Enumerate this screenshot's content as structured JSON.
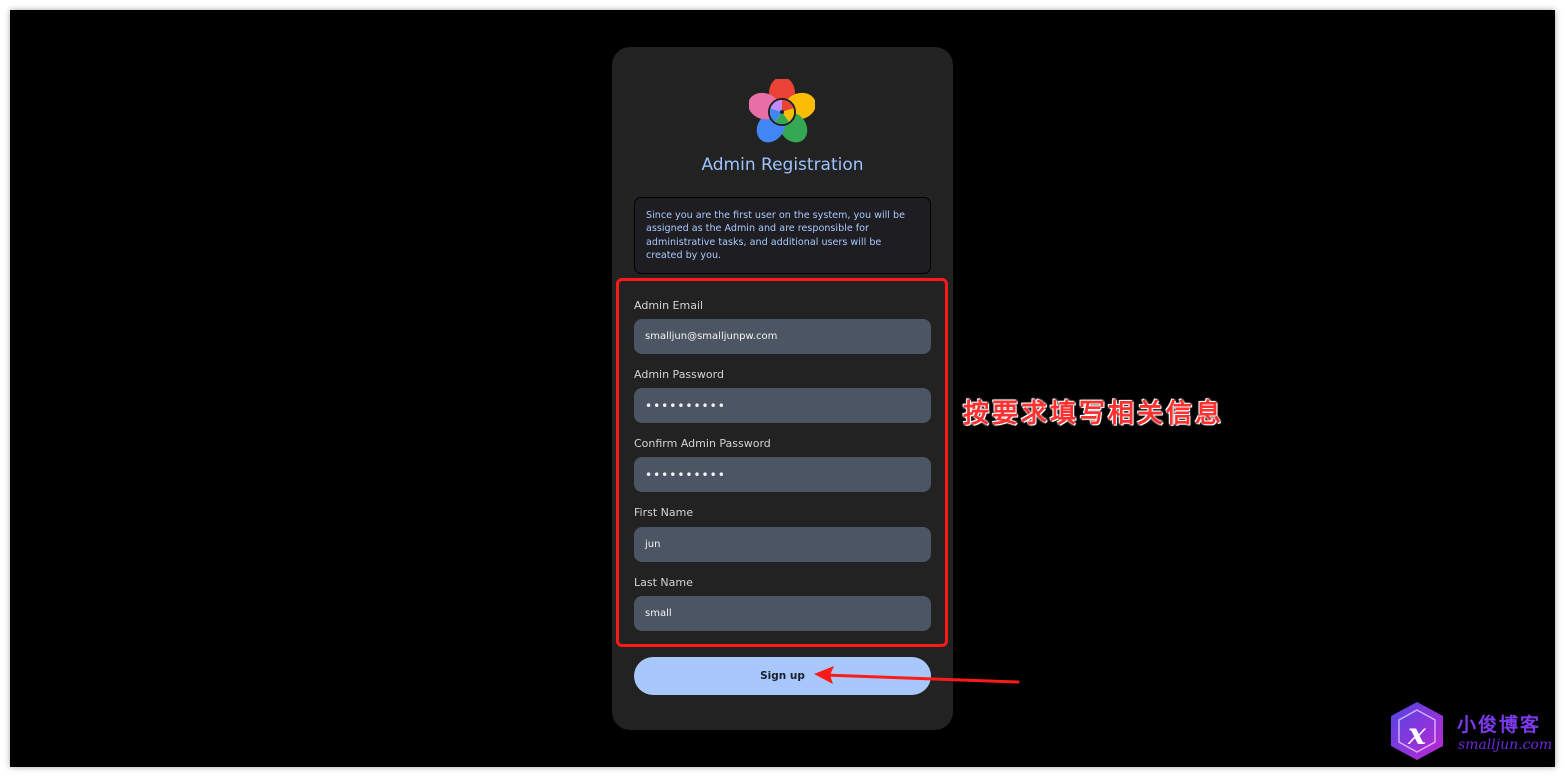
{
  "registration": {
    "title": "Admin Registration",
    "notice": "Since you are the first user on the system, you will be assigned as the Admin and are responsible for administrative tasks, and additional users will be created by you.",
    "fields": [
      {
        "label": "Admin Email",
        "value": "smalljun@smalljunpw.com",
        "type": "email"
      },
      {
        "label": "Admin Password",
        "value": "••••••••••",
        "type": "password"
      },
      {
        "label": "Confirm Admin Password",
        "value": "••••••••••",
        "type": "password"
      },
      {
        "label": "First Name",
        "value": "jun",
        "type": "text"
      },
      {
        "label": "Last Name",
        "value": "small",
        "type": "text"
      }
    ],
    "signup_label": "Sign up"
  },
  "annotation": {
    "text": "按要求填写相关信息",
    "color": "#ff3030"
  },
  "watermark": {
    "title": "小俊博客",
    "url": "smalljun.com"
  },
  "colors": {
    "background": "#000000",
    "card": "#222222",
    "accent": "#a8c7fa",
    "input": "#4b5563",
    "highlight": "#ff1a1a"
  },
  "icons": [
    "flower-logo-icon",
    "arrow-icon",
    "watermark-logo-icon"
  ]
}
